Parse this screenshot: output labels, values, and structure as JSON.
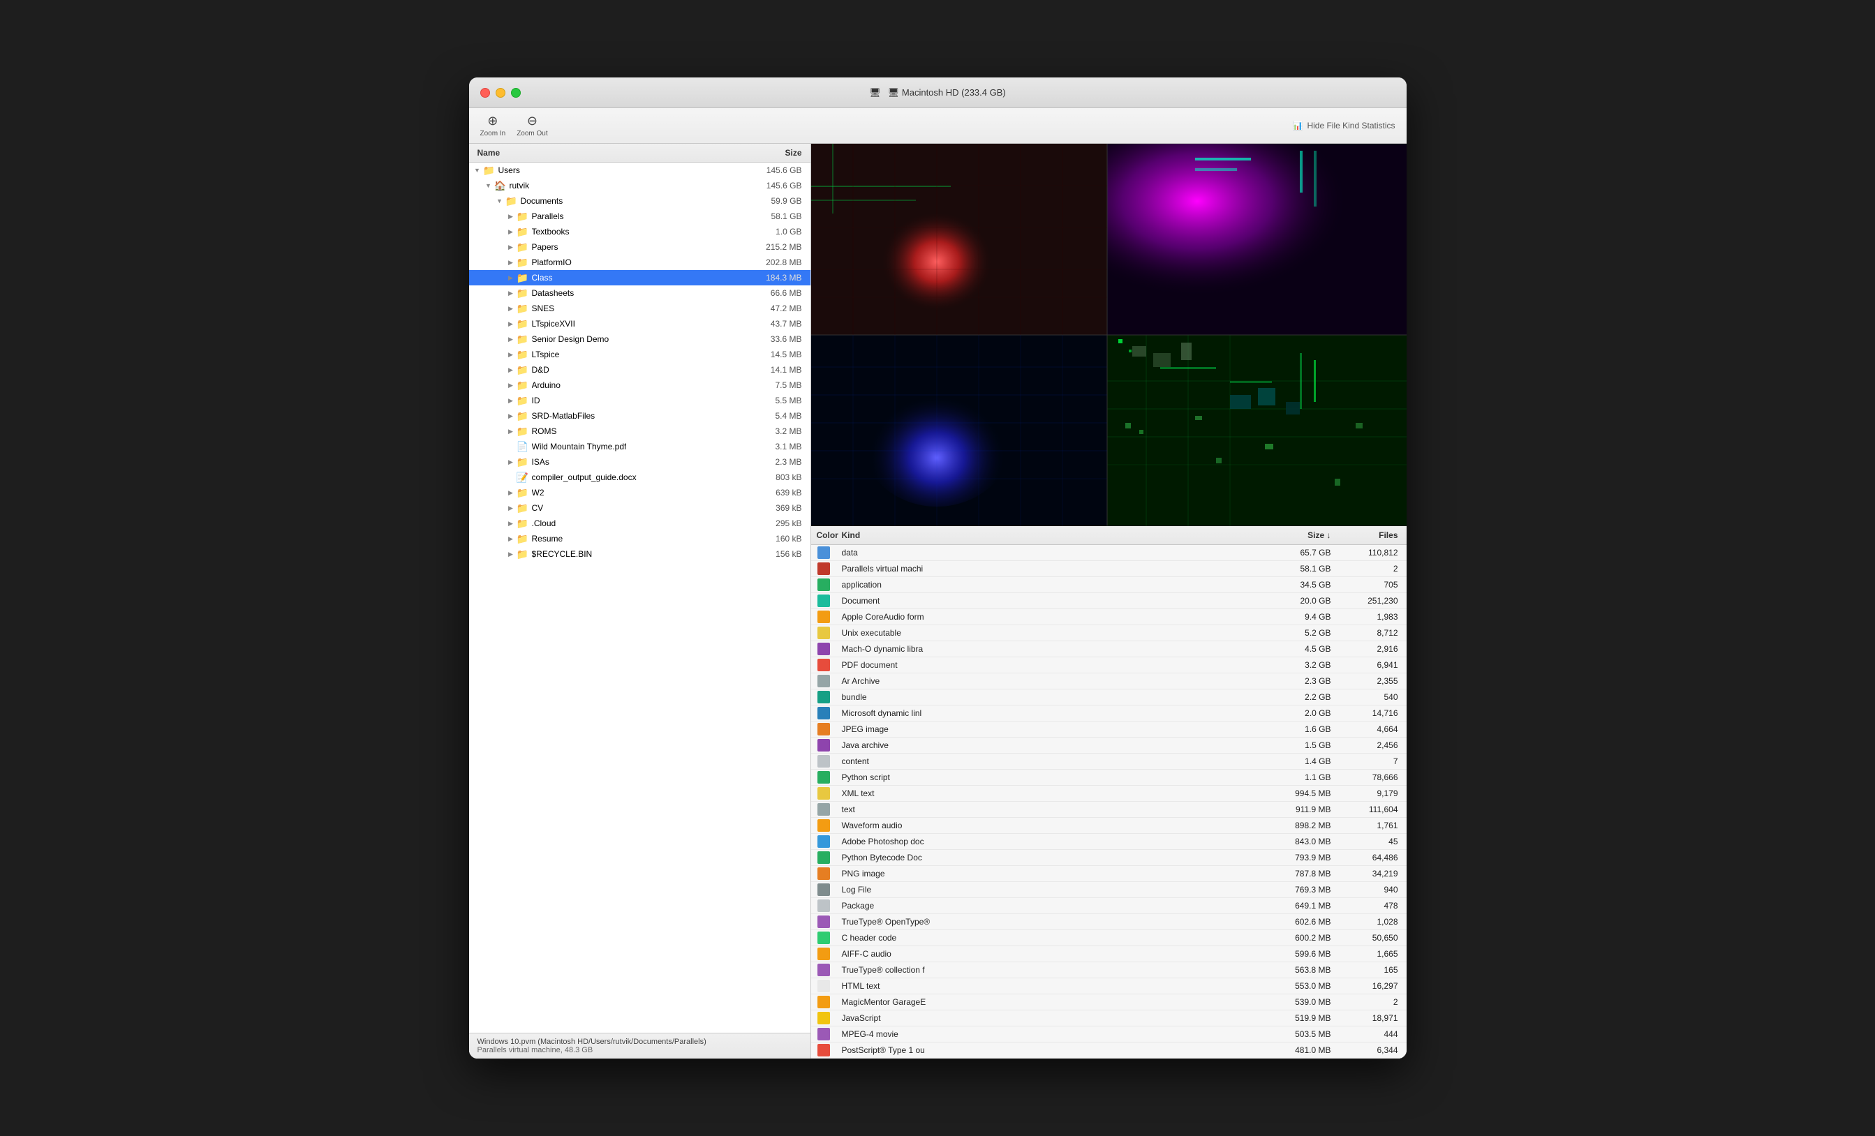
{
  "window": {
    "title": "🖥 Macintosh HD (233.4 GB)"
  },
  "toolbar": {
    "zoom_in": "Zoom In",
    "zoom_out": "Zoom Out",
    "hide_stats": "Hide File Kind Statistics"
  },
  "file_list": {
    "col_name": "Name",
    "col_size": "Size",
    "items": [
      {
        "id": "users",
        "label": "Users",
        "size": "145.6 GB",
        "indent": 0,
        "disclosure": "open",
        "icon": "folder",
        "selected": false
      },
      {
        "id": "rutvik",
        "label": "rutvik",
        "size": "145.6 GB",
        "indent": 1,
        "disclosure": "open",
        "icon": "folder-home",
        "selected": false
      },
      {
        "id": "documents",
        "label": "Documents",
        "size": "59.9 GB",
        "indent": 2,
        "disclosure": "open",
        "icon": "folder",
        "selected": false
      },
      {
        "id": "parallels",
        "label": "Parallels",
        "size": "58.1 GB",
        "indent": 3,
        "disclosure": "closed",
        "icon": "folder",
        "selected": false
      },
      {
        "id": "textbooks",
        "label": "Textbooks",
        "size": "1.0 GB",
        "indent": 3,
        "disclosure": "closed",
        "icon": "folder",
        "selected": false
      },
      {
        "id": "papers",
        "label": "Papers",
        "size": "215.2 MB",
        "indent": 3,
        "disclosure": "closed",
        "icon": "folder",
        "selected": false
      },
      {
        "id": "platformio",
        "label": "PlatformIO",
        "size": "202.8 MB",
        "indent": 3,
        "disclosure": "closed",
        "icon": "folder",
        "selected": false
      },
      {
        "id": "class",
        "label": "Class",
        "size": "184.3 MB",
        "indent": 3,
        "disclosure": "closed",
        "icon": "folder",
        "selected": true
      },
      {
        "id": "datasheets",
        "label": "Datasheets",
        "size": "66.6 MB",
        "indent": 3,
        "disclosure": "closed",
        "icon": "folder",
        "selected": false
      },
      {
        "id": "snes",
        "label": "SNES",
        "size": "47.2 MB",
        "indent": 3,
        "disclosure": "closed",
        "icon": "folder",
        "selected": false
      },
      {
        "id": "ltspicexvii",
        "label": "LTspiceXVII",
        "size": "43.7 MB",
        "indent": 3,
        "disclosure": "closed",
        "icon": "folder",
        "selected": false
      },
      {
        "id": "senior-design",
        "label": "Senior Design Demo",
        "size": "33.6 MB",
        "indent": 3,
        "disclosure": "closed",
        "icon": "folder",
        "selected": false
      },
      {
        "id": "ltspice",
        "label": "LTspice",
        "size": "14.5 MB",
        "indent": 3,
        "disclosure": "closed",
        "icon": "folder",
        "selected": false
      },
      {
        "id": "dd",
        "label": "D&D",
        "size": "14.1 MB",
        "indent": 3,
        "disclosure": "closed",
        "icon": "folder",
        "selected": false
      },
      {
        "id": "arduino",
        "label": "Arduino",
        "size": "7.5 MB",
        "indent": 3,
        "disclosure": "closed",
        "icon": "folder",
        "selected": false
      },
      {
        "id": "id",
        "label": "ID",
        "size": "5.5 MB",
        "indent": 3,
        "disclosure": "closed",
        "icon": "folder",
        "selected": false
      },
      {
        "id": "srd",
        "label": "SRD-MatlabFiles",
        "size": "5.4 MB",
        "indent": 3,
        "disclosure": "closed",
        "icon": "folder",
        "selected": false
      },
      {
        "id": "roms",
        "label": "ROMS",
        "size": "3.2 MB",
        "indent": 3,
        "disclosure": "closed",
        "icon": "folder",
        "selected": false
      },
      {
        "id": "wild-mountain",
        "label": "Wild Mountain Thyme.pdf",
        "size": "3.1 MB",
        "indent": 3,
        "disclosure": "none",
        "icon": "pdf",
        "selected": false
      },
      {
        "id": "isas",
        "label": "ISAs",
        "size": "2.3 MB",
        "indent": 3,
        "disclosure": "closed",
        "icon": "folder",
        "selected": false
      },
      {
        "id": "compiler-guide",
        "label": "compiler_output_guide.docx",
        "size": "803 kB",
        "indent": 3,
        "disclosure": "none",
        "icon": "doc",
        "selected": false
      },
      {
        "id": "w2",
        "label": "W2",
        "size": "639 kB",
        "indent": 3,
        "disclosure": "closed",
        "icon": "folder",
        "selected": false
      },
      {
        "id": "cv",
        "label": "CV",
        "size": "369 kB",
        "indent": 3,
        "disclosure": "closed",
        "icon": "folder",
        "selected": false
      },
      {
        "id": "cloud",
        "label": ".Cloud",
        "size": "295 kB",
        "indent": 3,
        "disclosure": "closed",
        "icon": "folder",
        "selected": false
      },
      {
        "id": "resume",
        "label": "Resume",
        "size": "160 kB",
        "indent": 3,
        "disclosure": "closed",
        "icon": "folder",
        "selected": false
      },
      {
        "id": "recycle",
        "label": "$RECYCLE.BIN",
        "size": "156 kB",
        "indent": 3,
        "disclosure": "closed",
        "icon": "folder-special",
        "selected": false
      }
    ]
  },
  "status_bar": {
    "line1": "Windows 10.pvm (Macintosh HD/Users/rutvik/Documents/Parallels)",
    "line2": "Parallels virtual machine, 48.3 GB"
  },
  "stats_panel": {
    "col_color": "Color",
    "col_kind": "Kind",
    "col_size": "Size",
    "col_size_sort": "↓",
    "col_files": "Files",
    "rows": [
      {
        "color": "#4a90d9",
        "kind": "data",
        "size": "65.7 GB",
        "files": "110,812"
      },
      {
        "color": "#c0392b",
        "kind": "Parallels virtual machi",
        "size": "58.1 GB",
        "files": "2"
      },
      {
        "color": "#27ae60",
        "kind": "application",
        "size": "34.5 GB",
        "files": "705"
      },
      {
        "color": "#1abc9c",
        "kind": "Document",
        "size": "20.0 GB",
        "files": "251,230"
      },
      {
        "color": "#f39c12",
        "kind": "Apple CoreAudio form",
        "size": "9.4 GB",
        "files": "1,983"
      },
      {
        "color": "#e8c840",
        "kind": "Unix executable",
        "size": "5.2 GB",
        "files": "8,712"
      },
      {
        "color": "#8e44ad",
        "kind": "Mach-O dynamic libra",
        "size": "4.5 GB",
        "files": "2,916"
      },
      {
        "color": "#e74c3c",
        "kind": "PDF document",
        "size": "3.2 GB",
        "files": "6,941"
      },
      {
        "color": "#95a5a6",
        "kind": "Ar Archive",
        "size": "2.3 GB",
        "files": "2,355"
      },
      {
        "color": "#16a085",
        "kind": "bundle",
        "size": "2.2 GB",
        "files": "540"
      },
      {
        "color": "#2980b9",
        "kind": "Microsoft dynamic linl",
        "size": "2.0 GB",
        "files": "14,716"
      },
      {
        "color": "#e67e22",
        "kind": "JPEG image",
        "size": "1.6 GB",
        "files": "4,664"
      },
      {
        "color": "#8e44ad",
        "kind": "Java archive",
        "size": "1.5 GB",
        "files": "2,456"
      },
      {
        "color": "#bdc3c7",
        "kind": "content",
        "size": "1.4 GB",
        "files": "7"
      },
      {
        "color": "#27ae60",
        "kind": "Python script",
        "size": "1.1 GB",
        "files": "78,666"
      },
      {
        "color": "#e8c840",
        "kind": "XML text",
        "size": "994.5 MB",
        "files": "9,179"
      },
      {
        "color": "#95a5a6",
        "kind": "text",
        "size": "911.9 MB",
        "files": "111,604"
      },
      {
        "color": "#f39c12",
        "kind": "Waveform audio",
        "size": "898.2 MB",
        "files": "1,761"
      },
      {
        "color": "#3498db",
        "kind": "Adobe Photoshop doc",
        "size": "843.0 MB",
        "files": "45"
      },
      {
        "color": "#27ae60",
        "kind": "Python Bytecode Doc",
        "size": "793.9 MB",
        "files": "64,486"
      },
      {
        "color": "#e67e22",
        "kind": "PNG image",
        "size": "787.8 MB",
        "files": "34,219"
      },
      {
        "color": "#7f8c8d",
        "kind": "Log File",
        "size": "769.3 MB",
        "files": "940"
      },
      {
        "color": "#bdc3c7",
        "kind": "Package",
        "size": "649.1 MB",
        "files": "478"
      },
      {
        "color": "#9b59b6",
        "kind": "TrueType® OpenType®",
        "size": "602.6 MB",
        "files": "1,028"
      },
      {
        "color": "#2ecc71",
        "kind": "C header code",
        "size": "600.2 MB",
        "files": "50,650"
      },
      {
        "color": "#f39c12",
        "kind": "AIFF-C audio",
        "size": "599.6 MB",
        "files": "1,665"
      },
      {
        "color": "#9b59b6",
        "kind": "TrueType® collection f",
        "size": "563.8 MB",
        "files": "165"
      },
      {
        "color": "#e8e8e8",
        "kind": "HTML text",
        "size": "553.0 MB",
        "files": "16,297"
      },
      {
        "color": "#f39c12",
        "kind": "MagicMentor GarageE",
        "size": "539.0 MB",
        "files": "2"
      },
      {
        "color": "#f1c40f",
        "kind": "JavaScript",
        "size": "519.9 MB",
        "files": "18,971"
      },
      {
        "color": "#9b59b6",
        "kind": "MPEG-4 movie",
        "size": "503.5 MB",
        "files": "444"
      },
      {
        "color": "#e74c3c",
        "kind": "PostScript® Type 1 ou",
        "size": "481.0 MB",
        "files": "6,344"
      }
    ]
  }
}
